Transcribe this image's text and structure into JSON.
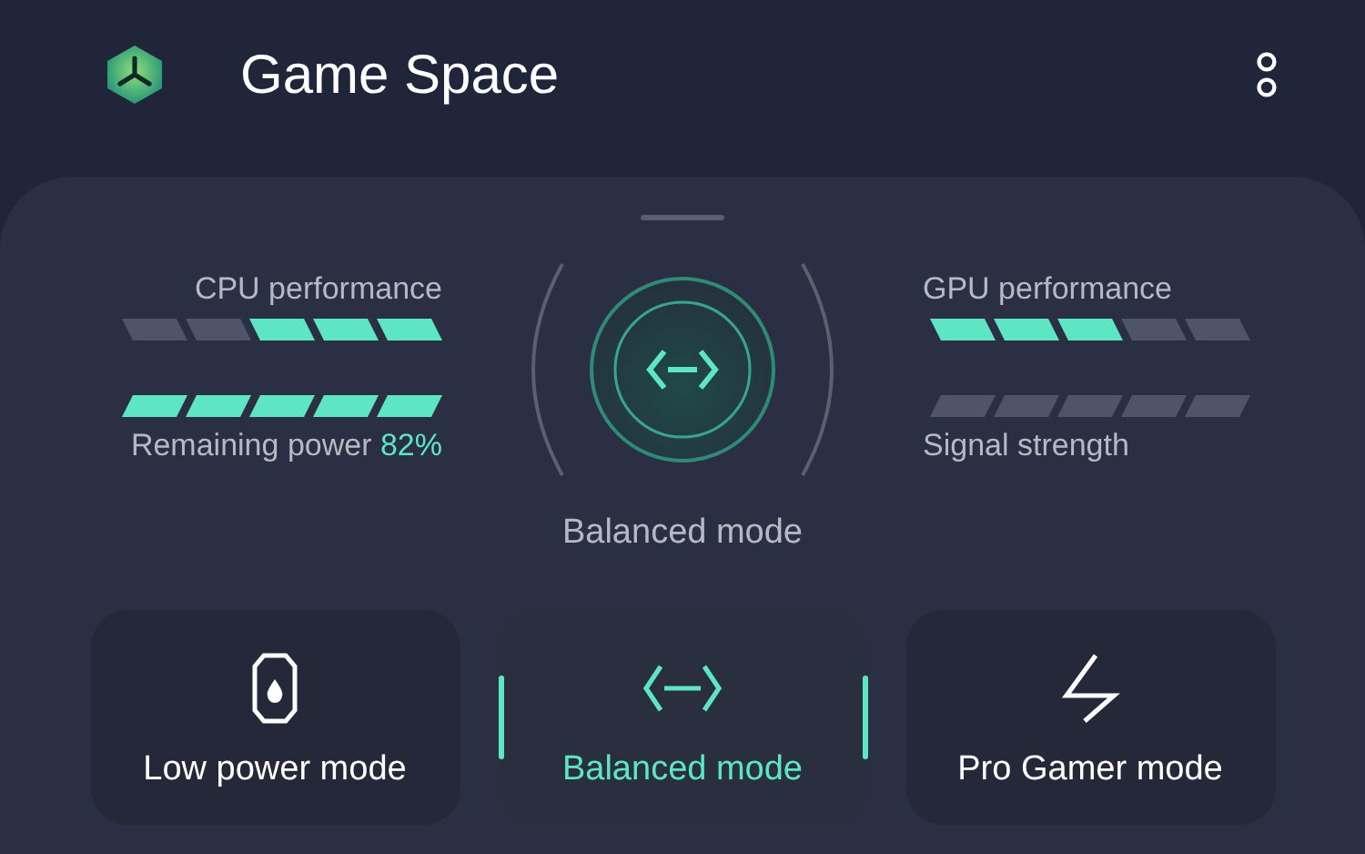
{
  "header": {
    "title": "Game Space"
  },
  "meters": [
    {
      "label": "CPU performance",
      "segments": [
        {
          "on": false
        },
        {
          "on": false
        },
        {
          "on": true
        },
        {
          "on": true
        },
        {
          "on": true
        }
      ]
    },
    {
      "label": "GPU performance",
      "segments": [
        {
          "on": true
        },
        {
          "on": true
        },
        {
          "on": true
        },
        {
          "on": false
        },
        {
          "on": false
        }
      ]
    },
    {
      "label": "Remaining power",
      "value": "82%",
      "segments": [
        {
          "on": true
        },
        {
          "on": true
        },
        {
          "on": true
        },
        {
          "on": true
        },
        {
          "on": true
        }
      ]
    },
    {
      "label": "Signal strength",
      "segments": [
        {
          "on": false
        },
        {
          "on": false
        },
        {
          "on": false
        },
        {
          "on": false
        },
        {
          "on": false
        }
      ]
    }
  ],
  "current_mode": "Balanced mode",
  "modes": [
    {
      "label": "Low power mode",
      "kind": "battery",
      "selected": false
    },
    {
      "label": "Balanced mode",
      "kind": "balanced",
      "selected": true
    },
    {
      "label": "Pro Gamer mode",
      "kind": "bolt",
      "selected": false
    }
  ]
}
